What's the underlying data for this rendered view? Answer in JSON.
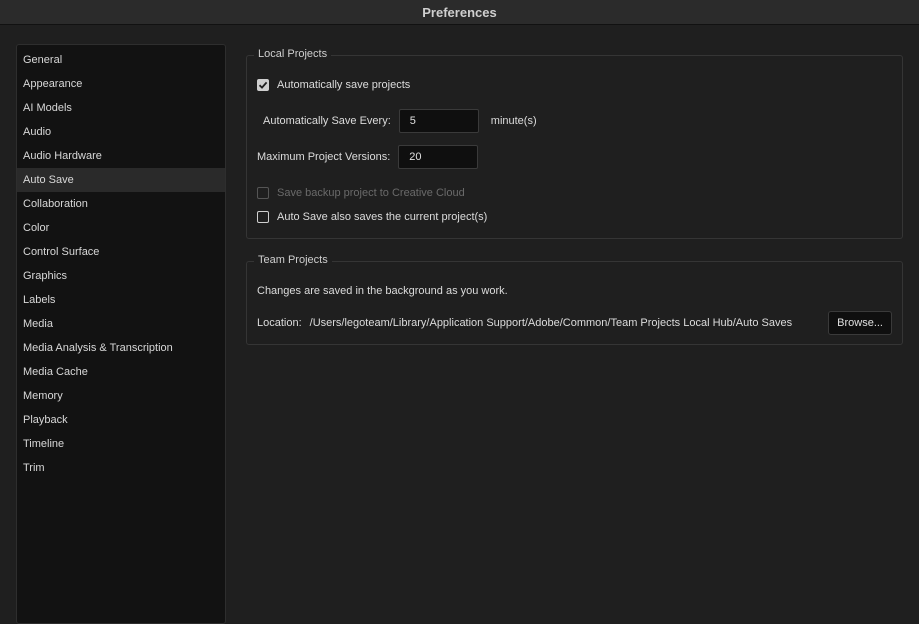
{
  "window": {
    "title": "Preferences"
  },
  "sidebar": {
    "selected_index": 5,
    "items": [
      {
        "label": "General"
      },
      {
        "label": "Appearance"
      },
      {
        "label": "AI Models"
      },
      {
        "label": "Audio"
      },
      {
        "label": "Audio Hardware"
      },
      {
        "label": "Auto Save"
      },
      {
        "label": "Collaboration"
      },
      {
        "label": "Color"
      },
      {
        "label": "Control Surface"
      },
      {
        "label": "Graphics"
      },
      {
        "label": "Labels"
      },
      {
        "label": "Media"
      },
      {
        "label": "Media Analysis & Transcription"
      },
      {
        "label": "Media Cache"
      },
      {
        "label": "Memory"
      },
      {
        "label": "Playback"
      },
      {
        "label": "Timeline"
      },
      {
        "label": "Trim"
      }
    ]
  },
  "local_projects": {
    "title": "Local Projects",
    "auto_save": {
      "label": "Automatically save projects",
      "checked": true
    },
    "save_every": {
      "label": "Automatically Save Every:",
      "value": "5",
      "unit": "minute(s)"
    },
    "max_versions": {
      "label": "Maximum Project Versions:",
      "value": "20"
    },
    "backup_cloud": {
      "label": "Save backup project to Creative Cloud",
      "checked": false,
      "disabled": true
    },
    "save_current": {
      "label": "Auto Save also saves the current project(s)",
      "checked": false
    }
  },
  "team_projects": {
    "title": "Team Projects",
    "description": "Changes are saved in the background as you work.",
    "location_label": "Location:",
    "location_path": "/Users/legoteam/Library/Application Support/Adobe/Common/Team Projects Local Hub/Auto Saves",
    "browse_label": "Browse..."
  }
}
